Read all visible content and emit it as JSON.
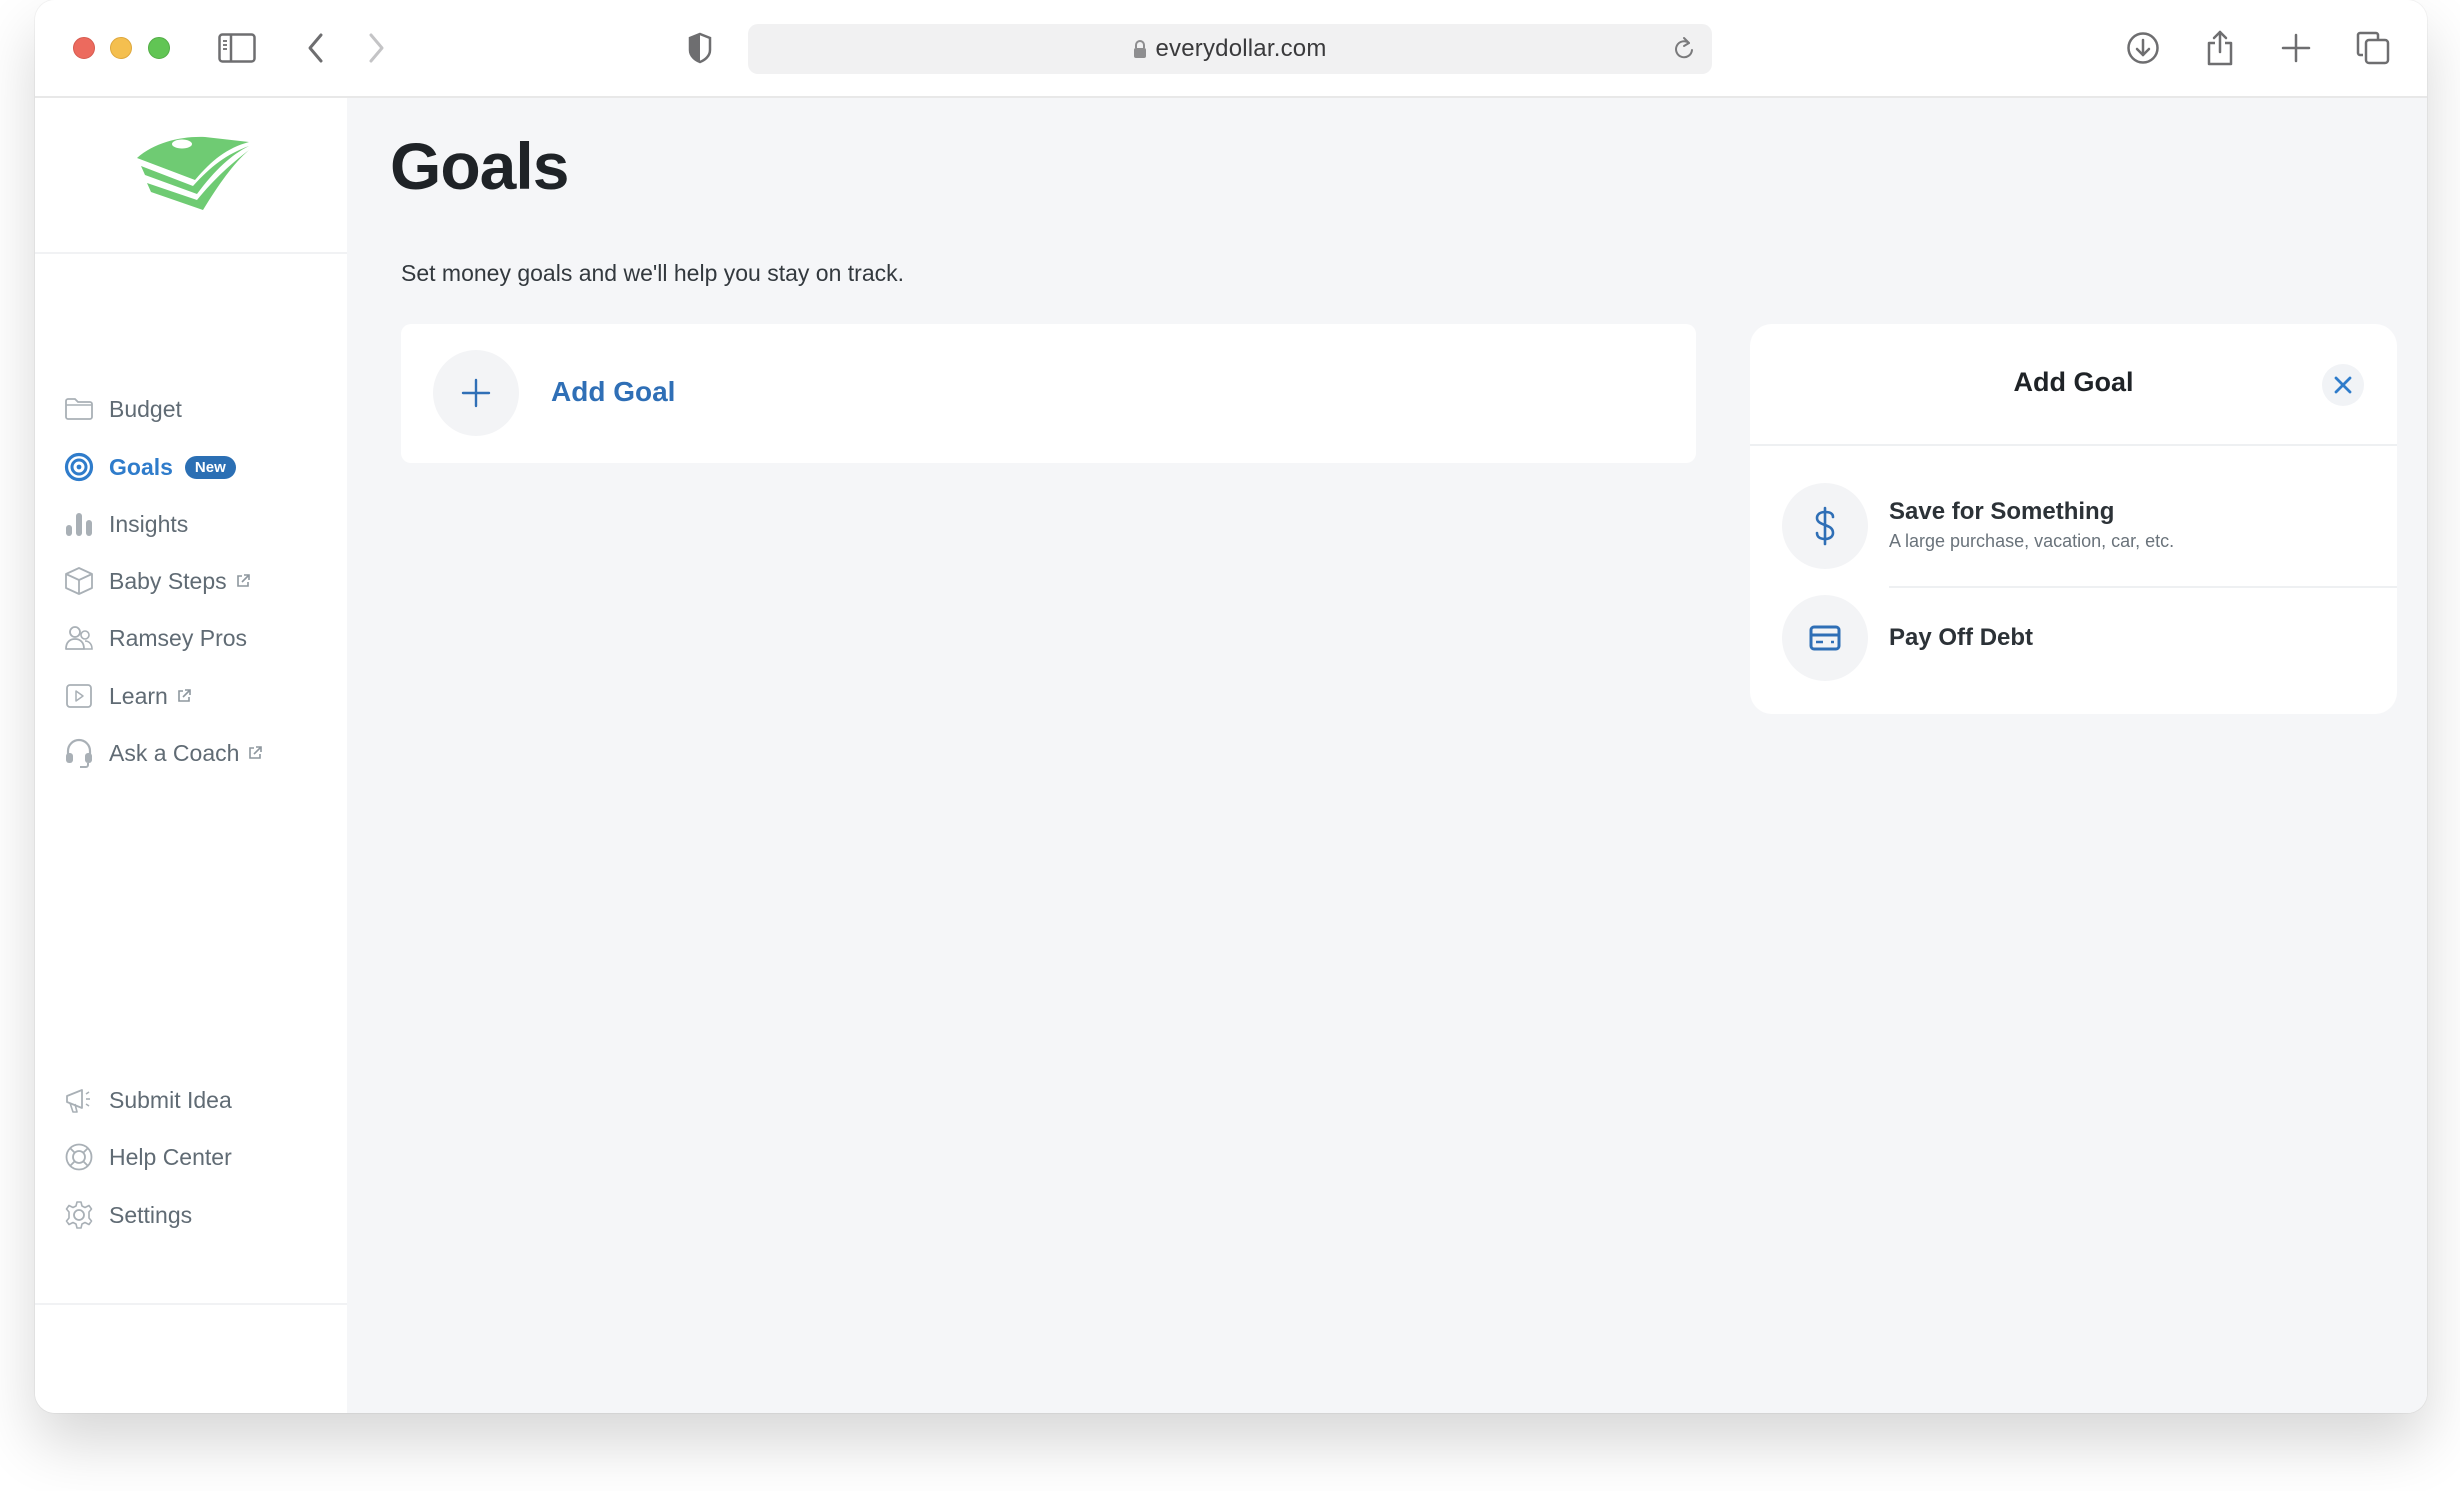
{
  "browser": {
    "url": "everydollar.com",
    "icons": {
      "sidebar_toggle": "sidebar-toggle-icon",
      "back": "chevron-left-icon",
      "forward": "chevron-right-icon",
      "privacy": "shield-icon",
      "lock": "lock-icon",
      "reload": "reload-icon",
      "download": "download-icon",
      "share": "share-icon",
      "new_tab": "plus-icon",
      "tabs": "tab-overview-icon"
    }
  },
  "colors": {
    "accent": "#2f7ccb",
    "badge": "#2b6fb4",
    "logo_green": "#6fcb73",
    "main_bg": "#f5f6f8"
  },
  "sidebar": {
    "logo": "everydollar-logo",
    "items": [
      {
        "label": "Budget",
        "icon": "folder-icon",
        "external": false,
        "active": false
      },
      {
        "label": "Goals",
        "icon": "target-icon",
        "external": false,
        "active": true,
        "badge": "New"
      },
      {
        "label": "Insights",
        "icon": "bar-chart-icon",
        "external": false,
        "active": false
      },
      {
        "label": "Baby Steps",
        "icon": "cube-icon",
        "external": true,
        "active": false
      },
      {
        "label": "Ramsey Pros",
        "icon": "people-icon",
        "external": false,
        "active": false
      },
      {
        "label": "Learn",
        "icon": "play-icon",
        "external": true,
        "active": false
      },
      {
        "label": "Ask a Coach",
        "icon": "headset-icon",
        "external": true,
        "active": false
      }
    ],
    "bottom_items": [
      {
        "label": "Submit Idea",
        "icon": "megaphone-icon"
      },
      {
        "label": "Help Center",
        "icon": "lifebuoy-icon"
      },
      {
        "label": "Settings",
        "icon": "gear-icon"
      }
    ]
  },
  "main": {
    "title": "Goals",
    "subtitle": "Set money goals and we'll help you stay on track.",
    "add_goal_label": "Add Goal"
  },
  "panel": {
    "title": "Add Goal",
    "options": [
      {
        "title": "Save for Something",
        "subtitle": "A large purchase, vacation, car, etc.",
        "icon": "dollar-icon"
      },
      {
        "title": "Pay Off Debt",
        "subtitle": "",
        "icon": "credit-card-icon"
      }
    ]
  }
}
